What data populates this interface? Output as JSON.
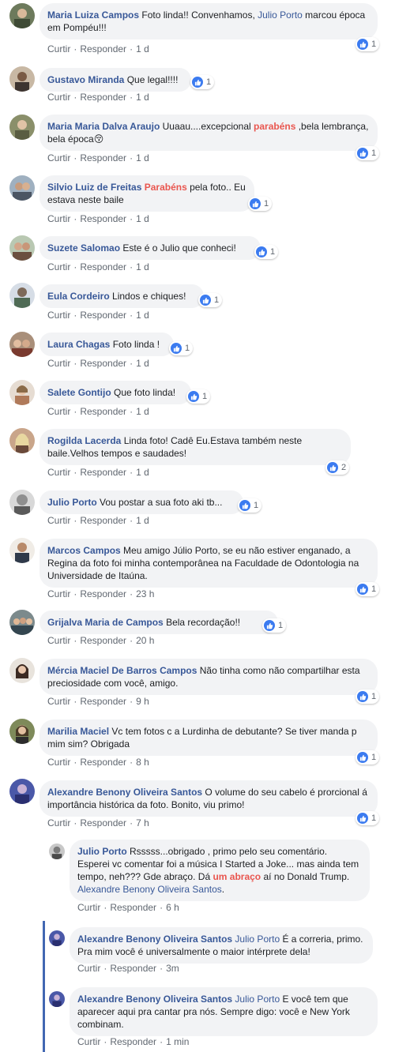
{
  "comments": [
    {
      "name": "Maria Luiza Campos",
      "parts": [
        {
          "t": "Foto linda!! Convenhamos, "
        },
        {
          "t": "Julio Porto",
          "c": "mention"
        },
        {
          "t": " marcou época em Pompéu!!!"
        }
      ],
      "time": "1 d",
      "likes": "1"
    },
    {
      "name": "Gustavo Miranda",
      "parts": [
        {
          "t": "Que legal!!!!"
        }
      ],
      "time": "1 d",
      "likes": "1"
    },
    {
      "name": "Maria Maria Dalva Araujo",
      "parts": [
        {
          "t": "Uuaau....excepcional "
        },
        {
          "t": "parabéns",
          "c": "hl"
        },
        {
          "t": " ,bela lembrança, bela época😚"
        }
      ],
      "time": "1 d",
      "likes": "1"
    },
    {
      "name": "Silvio Luiz de Freitas",
      "parts": [
        {
          "t": "Parabéns",
          "c": "hl"
        },
        {
          "t": " pela foto.. Eu estava neste baile"
        }
      ],
      "time": "1 d",
      "likes": "1"
    },
    {
      "name": "Suzete Salomao",
      "parts": [
        {
          "t": "Este é o Julio que conheci!"
        }
      ],
      "time": "1 d",
      "likes": "1"
    },
    {
      "name": "Eula Cordeiro",
      "parts": [
        {
          "t": "Lindos e chiques!"
        }
      ],
      "time": "1 d",
      "likes": "1"
    },
    {
      "name": "Laura Chagas",
      "parts": [
        {
          "t": "Foto linda !"
        }
      ],
      "time": "1 d",
      "likes": "1"
    },
    {
      "name": "Salete Gontijo",
      "parts": [
        {
          "t": "Que foto linda!"
        }
      ],
      "time": "1 d",
      "likes": "1"
    },
    {
      "name": "Rogilda Lacerda",
      "parts": [
        {
          "t": "Linda foto! Cadê Eu.Estava também neste baile.Velhos tempos e saudades!"
        }
      ],
      "time": "1 d",
      "likes": "2"
    },
    {
      "name": "Julio Porto",
      "parts": [
        {
          "t": "Vou postar a sua foto aki tb..."
        }
      ],
      "time": "1 d",
      "likes": "1"
    },
    {
      "name": "Marcos Campos",
      "parts": [
        {
          "t": "Meu amigo Júlio Porto, se eu não estiver enganado, a Regina da foto foi minha contemporânea na Faculdade de Odontologia na Universidade de Itaúna."
        }
      ],
      "time": "23 h",
      "likes": "1"
    },
    {
      "name": "Grijalva Maria de Campos",
      "parts": [
        {
          "t": "Bela recordação!!"
        }
      ],
      "time": "20 h",
      "likes": "1"
    },
    {
      "name": "Mércia Maciel De Barros Campos",
      "parts": [
        {
          "t": "Não tinha como não compartilhar esta preciosidade com você, amigo."
        }
      ],
      "time": "9 h",
      "likes": "1"
    },
    {
      "name": "Marilia Maciel",
      "parts": [
        {
          "t": "Vc tem fotos c a Lurdinha de debutante? Se tiver manda p mim sim? Obrigada"
        }
      ],
      "time": "8 h",
      "likes": "1"
    },
    {
      "name": "Alexandre Benony Oliveira Santos",
      "parts": [
        {
          "t": "O volume do seu cabelo é prorcional á importância histórica da foto. Bonito, viu primo!"
        }
      ],
      "time": "7 h",
      "likes": "1"
    },
    {
      "name": "Julio Porto",
      "parts": [
        {
          "t": "Rsssss...obrigado , primo pelo seu comentário. Esperei vc comentar foi a música I Started a Joke... mas ainda tem tempo, neh??? Gde abraço. Dá "
        },
        {
          "t": "um abraço",
          "c": "hl"
        },
        {
          "t": " aí no Donald Trump. "
        },
        {
          "t": "Alexandre Benony Oliveira Santos",
          "c": "mention"
        },
        {
          "t": "."
        }
      ],
      "time": "6 h",
      "likes": ""
    },
    {
      "name": "Alexandre Benony Oliveira Santos",
      "parts": [
        {
          "t": "Julio Porto",
          "c": "mention"
        },
        {
          "t": " É a correria, primo. Pra mim você é universalmente o maior intérprete dela!"
        }
      ],
      "time": "3m",
      "likes": ""
    },
    {
      "name": "Alexandre Benony Oliveira Santos",
      "parts": [
        {
          "t": "Julio Porto",
          "c": "mention"
        },
        {
          "t": " E você tem que aparecer aqui pra cantar pra nós. Sempre digo: você e New York combinam."
        }
      ],
      "time": "1 min",
      "likes": ""
    }
  ],
  "labels": {
    "like": "Curtir",
    "reply": "Responder",
    "sep": "·"
  },
  "colors": {
    "link": "#385898",
    "highlight": "#e9564f",
    "bubble": "#f2f3f5",
    "like_badge": "#3b7bf0",
    "thread": "#4267b2"
  }
}
